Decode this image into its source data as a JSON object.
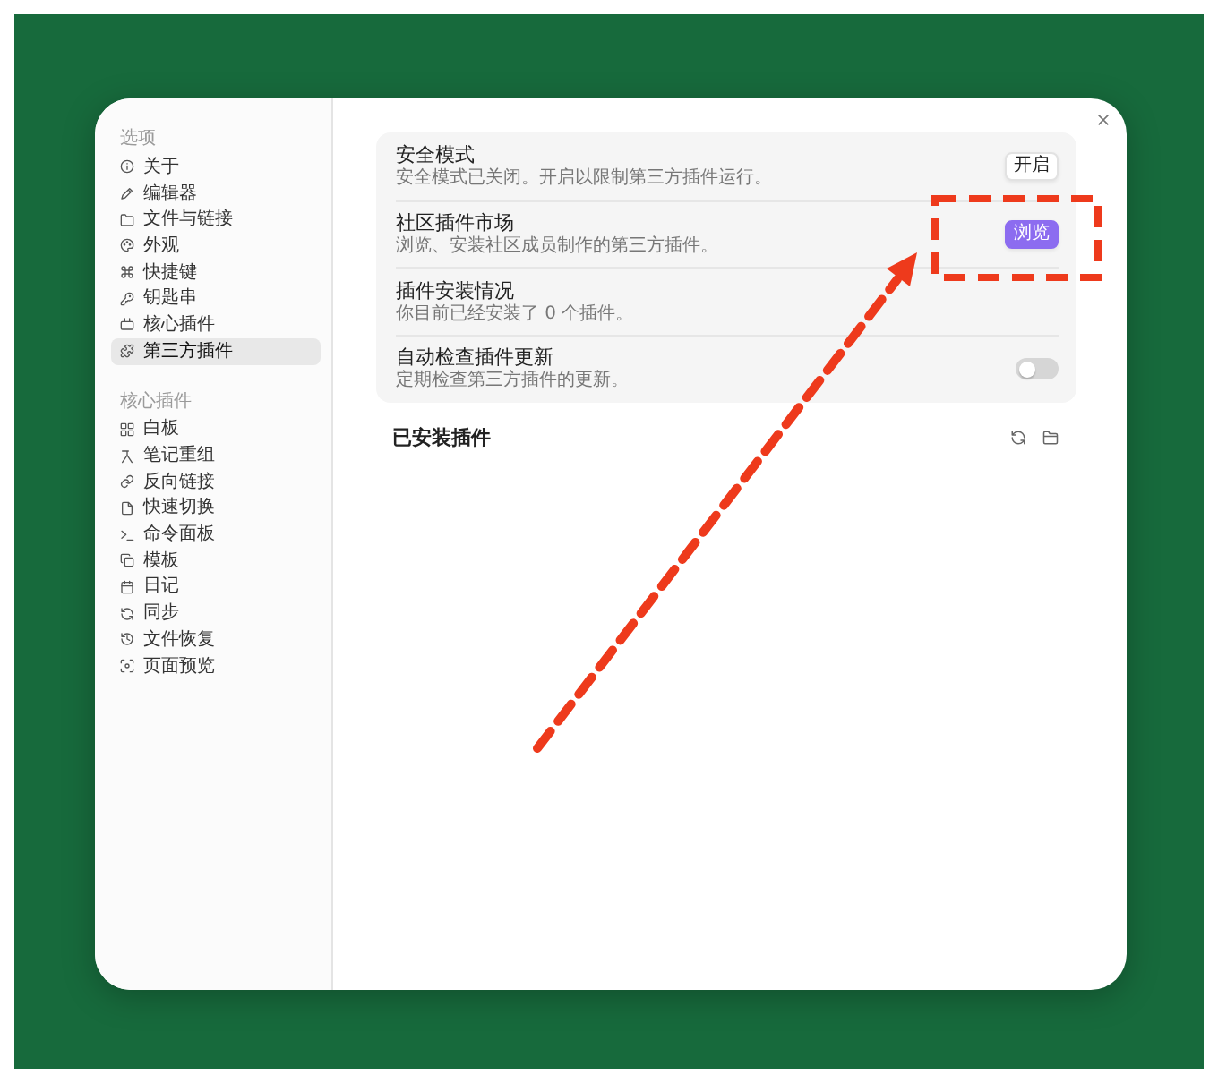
{
  "sidebar": {
    "sections": [
      {
        "label": "选项",
        "items": [
          {
            "label": "关于",
            "selected": false
          },
          {
            "label": "编辑器",
            "selected": false
          },
          {
            "label": "文件与链接",
            "selected": false
          },
          {
            "label": "外观",
            "selected": false
          },
          {
            "label": "快捷键",
            "selected": false
          },
          {
            "label": "钥匙串",
            "selected": false
          },
          {
            "label": "核心插件",
            "selected": false
          },
          {
            "label": "第三方插件",
            "selected": true
          }
        ]
      },
      {
        "label": "核心插件",
        "items": [
          {
            "label": "白板",
            "selected": false
          },
          {
            "label": "笔记重组",
            "selected": false
          },
          {
            "label": "反向链接",
            "selected": false
          },
          {
            "label": "快速切换",
            "selected": false
          },
          {
            "label": "命令面板",
            "selected": false
          },
          {
            "label": "模板",
            "selected": false
          },
          {
            "label": "日记",
            "selected": false
          },
          {
            "label": "同步",
            "selected": false
          },
          {
            "label": "文件恢复",
            "selected": false
          },
          {
            "label": "页面预览",
            "selected": false
          }
        ]
      }
    ]
  },
  "settings": {
    "rows": [
      {
        "title": "安全模式",
        "description": "安全模式已关闭。开启以限制第三方插件运行。",
        "control": {
          "kind": "button",
          "label": "开启",
          "primary": false
        }
      },
      {
        "title": "社区插件市场",
        "description": "浏览、安装社区成员制作的第三方插件。",
        "control": {
          "kind": "button",
          "label": "浏览",
          "primary": true
        }
      },
      {
        "title": "插件安装情况",
        "description": "你目前已经安装了 0 个插件。"
      },
      {
        "title": "自动检查插件更新",
        "description": "定期检查第三方插件的更新。",
        "control": {
          "kind": "toggle",
          "on": false
        }
      }
    ]
  },
  "installed_plugins": {
    "title": "已安装插件"
  },
  "annotation": {
    "highlight_box": true,
    "arrow": true
  }
}
